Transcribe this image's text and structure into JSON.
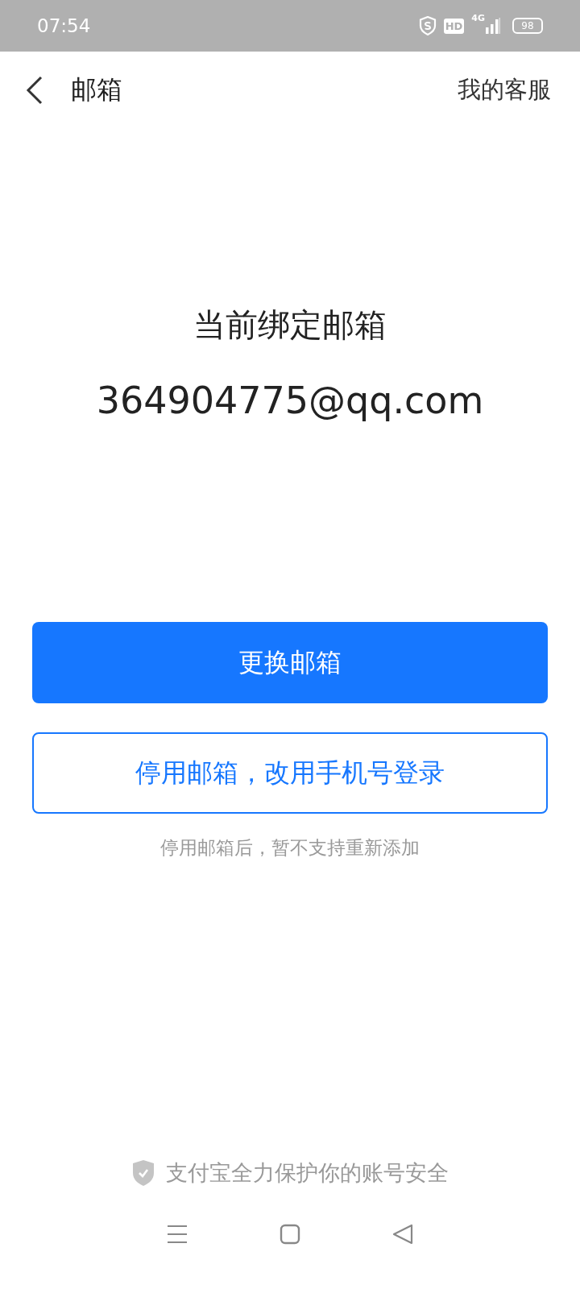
{
  "status_bar": {
    "time": "07:54",
    "hd": "HD",
    "network": "4G",
    "battery": "98"
  },
  "header": {
    "title": "邮箱",
    "action": "我的客服"
  },
  "current": {
    "label": "当前绑定邮箱",
    "email": "364904775@qq.com"
  },
  "buttons": [
    {
      "kind": "primary",
      "label": "更换邮箱"
    },
    {
      "kind": "outline",
      "label": "停用邮箱，改用手机号登录"
    }
  ],
  "note": "停用邮箱后，暂不支持重新添加",
  "footer": "支付宝全力保护你的账号安全"
}
